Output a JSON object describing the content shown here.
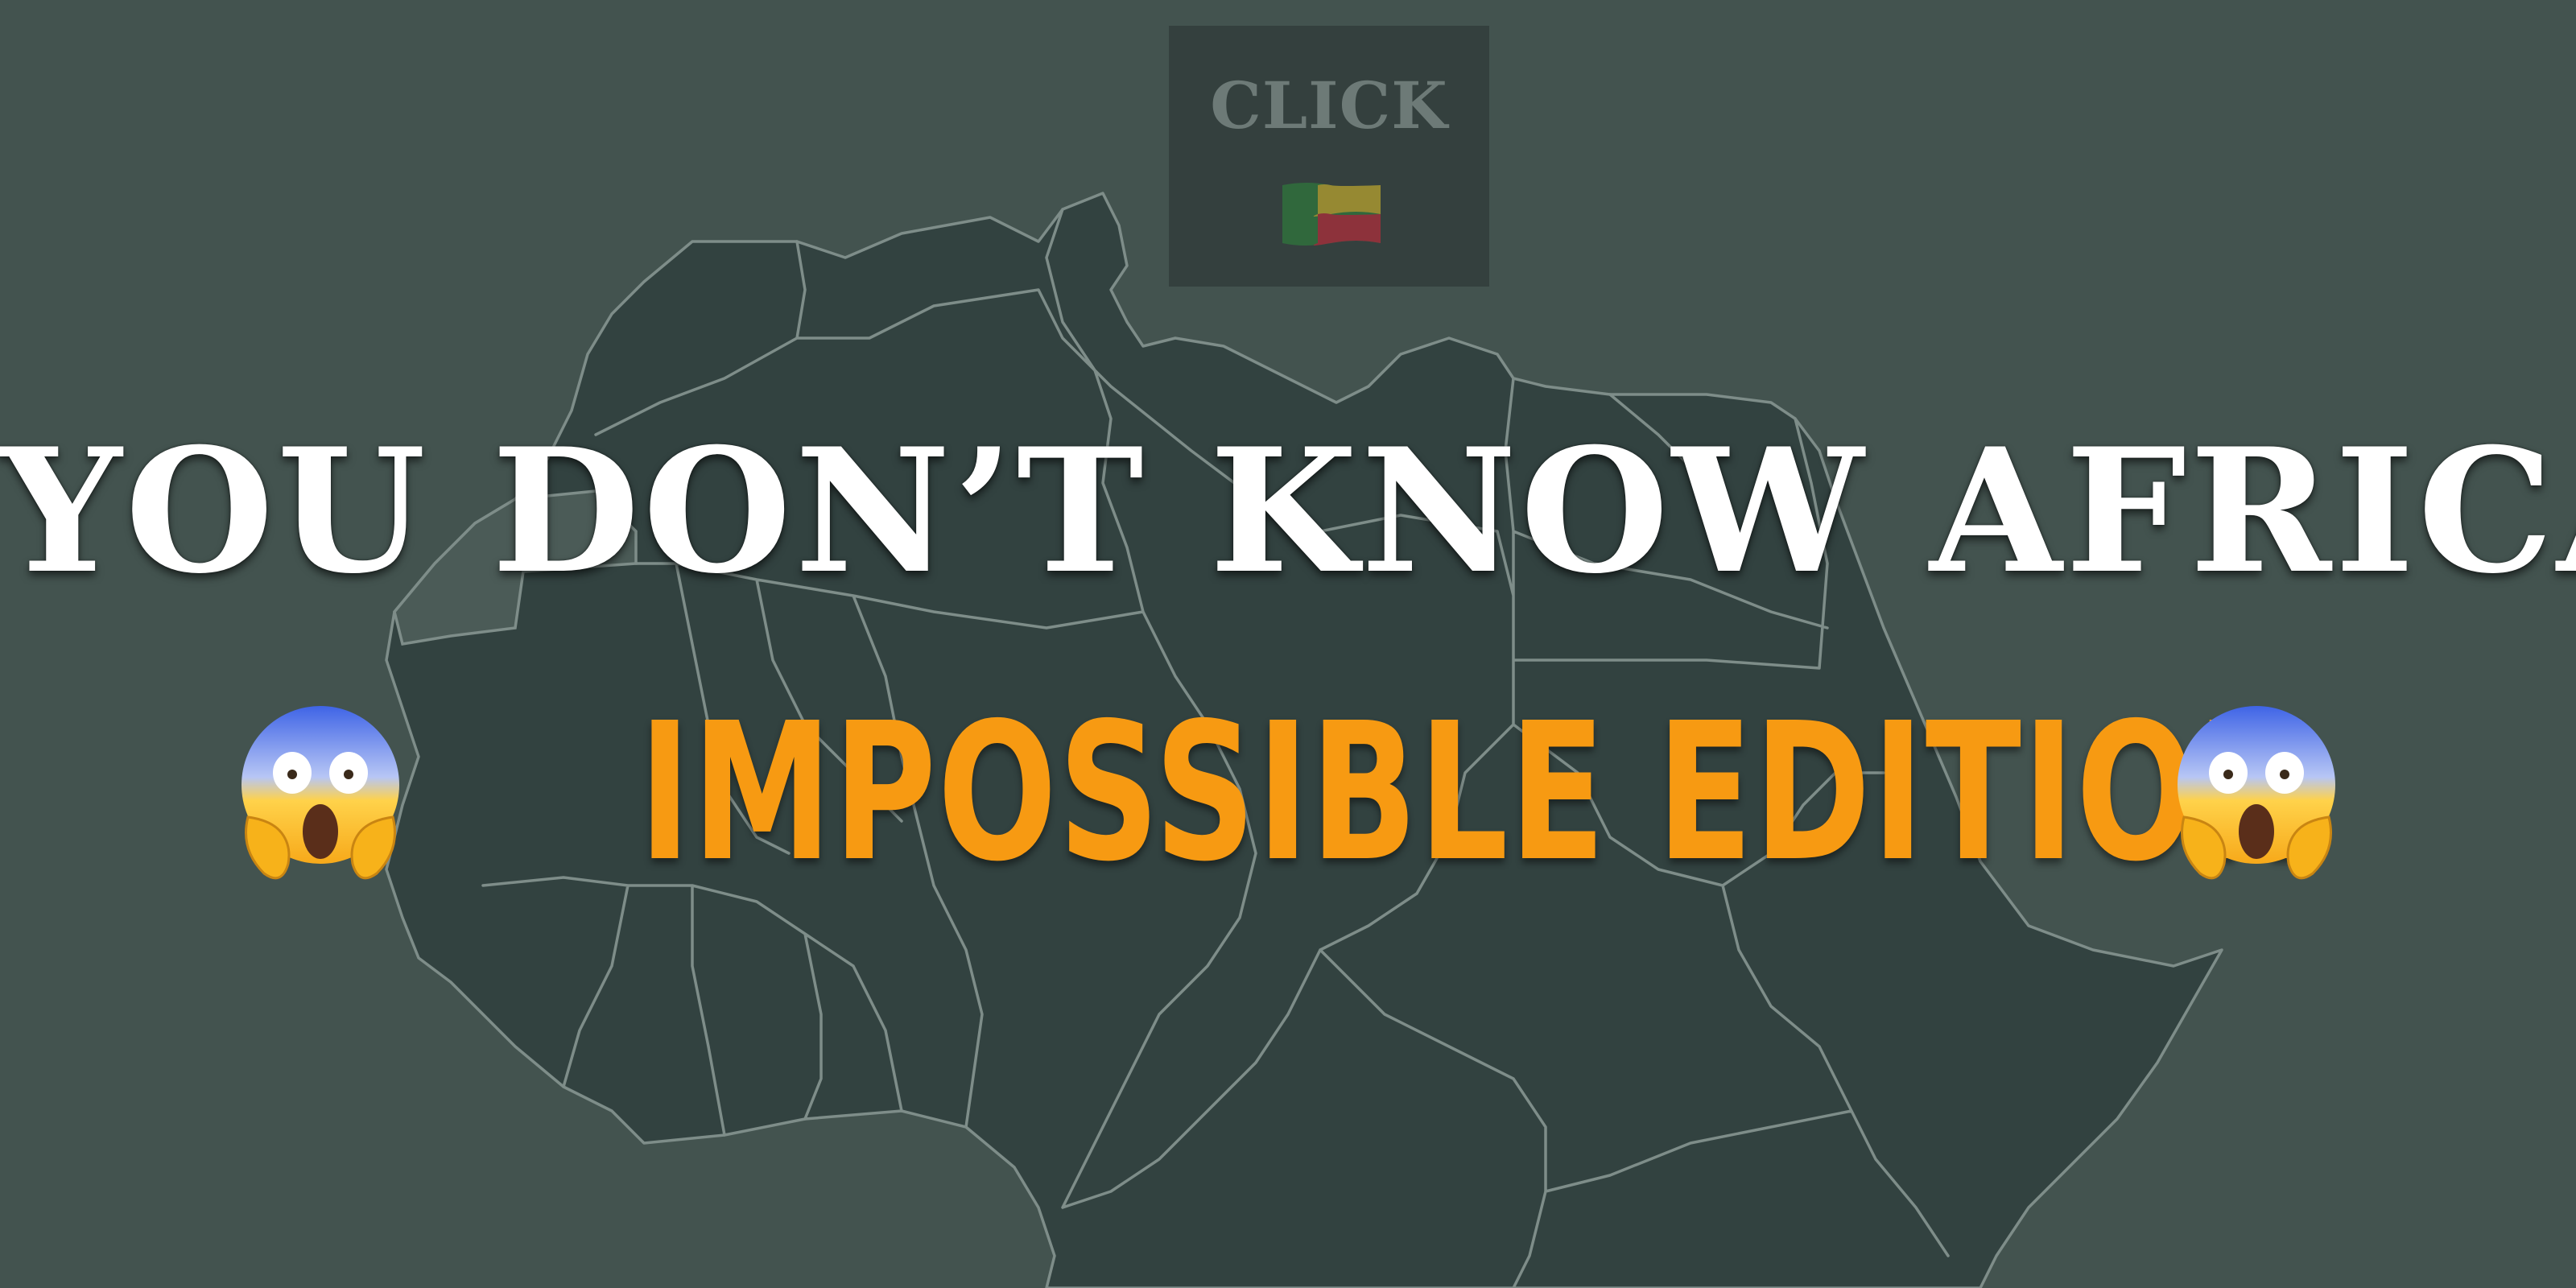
{
  "thumbnail": {
    "click_card": {
      "label": "CLICK",
      "flag_icon": "benin-flag-icon"
    },
    "title": "YOU DON’T KNOW AFRICA",
    "subtitle": "IMPOSSIBLE EDITION",
    "emoji_left": "face-screaming-in-fear-icon",
    "emoji_right": "face-screaming-in-fear-icon"
  },
  "colors": {
    "background": "#43534f",
    "land": "#324240",
    "borders": "#7e8d89",
    "title_text": "#ffffff",
    "subtitle_text": "#f79a12",
    "card_background": "#34403e",
    "card_text": "#6d7a77"
  }
}
